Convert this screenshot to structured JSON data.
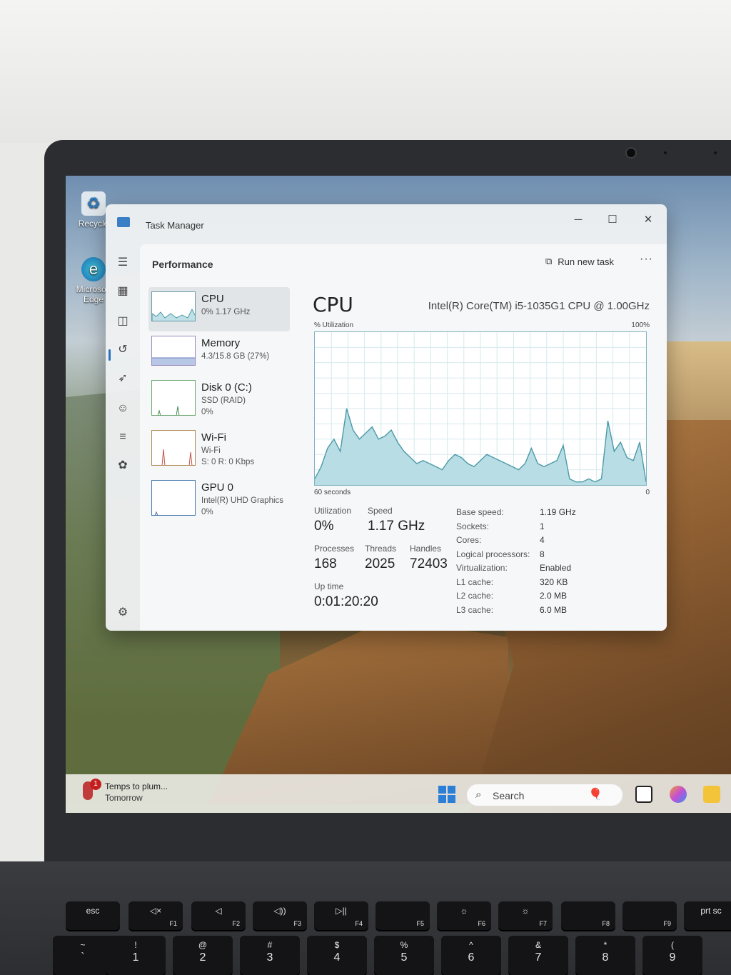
{
  "desktop": {
    "icons": [
      {
        "label": "Recycle",
        "icon": "recycle-bin-icon"
      },
      {
        "label": "Microsoft Edge",
        "icon": "edge-icon"
      }
    ]
  },
  "window": {
    "title": "Task Manager",
    "controls": {
      "minimize": "─",
      "maximize": "☐",
      "close": "✕"
    }
  },
  "header": {
    "section": "Performance",
    "run_new_task": "Run new task",
    "more": "···"
  },
  "resources": [
    {
      "name": "CPU",
      "sub1": "0%  1.17 GHz",
      "sub2": "",
      "sub3": ""
    },
    {
      "name": "Memory",
      "sub1": "4.3/15.8 GB (27%)",
      "sub2": "",
      "sub3": ""
    },
    {
      "name": "Disk 0 (C:)",
      "sub1": "SSD (RAID)",
      "sub2": "0%",
      "sub3": ""
    },
    {
      "name": "Wi-Fi",
      "sub1": "Wi-Fi",
      "sub2": "S: 0 R: 0 Kbps",
      "sub3": ""
    },
    {
      "name": "GPU 0",
      "sub1": "Intel(R) UHD Graphics",
      "sub2": "0%",
      "sub3": ""
    }
  ],
  "detail": {
    "title": "CPU",
    "model": "Intel(R) Core(TM) i5-1035G1 CPU @ 1.00GHz",
    "util_label": "% Utilization",
    "util_max": "100%",
    "time_left": "60 seconds",
    "time_right": "0",
    "stats": {
      "utilization_label": "Utilization",
      "utilization": "0%",
      "speed_label": "Speed",
      "speed": "1.17 GHz",
      "processes_label": "Processes",
      "processes": "168",
      "threads_label": "Threads",
      "threads": "2025",
      "handles_label": "Handles",
      "handles": "72403",
      "uptime_label": "Up time",
      "uptime": "0:01:20:20"
    },
    "specs": [
      {
        "label": "Base speed:",
        "value": "1.19 GHz"
      },
      {
        "label": "Sockets:",
        "value": "1"
      },
      {
        "label": "Cores:",
        "value": "4"
      },
      {
        "label": "Logical processors:",
        "value": "8"
      },
      {
        "label": "Virtualization:",
        "value": "Enabled"
      },
      {
        "label": "L1 cache:",
        "value": "320 KB"
      },
      {
        "label": "L2 cache:",
        "value": "2.0 MB"
      },
      {
        "label": "L3 cache:",
        "value": "6.0 MB"
      }
    ]
  },
  "chart_data": {
    "type": "area",
    "ylim": [
      0,
      100
    ],
    "values": [
      4,
      12,
      24,
      30,
      22,
      50,
      36,
      30,
      34,
      38,
      30,
      32,
      36,
      28,
      22,
      18,
      14,
      16,
      14,
      12,
      10,
      16,
      20,
      18,
      14,
      12,
      16,
      20,
      18,
      16,
      14,
      12,
      10,
      14,
      24,
      14,
      12,
      14,
      16,
      26,
      4,
      2,
      2,
      4,
      2,
      4,
      42,
      22,
      28,
      18,
      16,
      28,
      2
    ]
  },
  "taskbar": {
    "weather_title": "Temps to plum...",
    "weather_sub": "Tomorrow",
    "weather_badge": "1",
    "search": "Search"
  },
  "keyboard": [
    {
      "top": "esc",
      "bot": ""
    },
    {
      "top": "◁×",
      "bot": "F1"
    },
    {
      "top": "◁",
      "bot": "F2"
    },
    {
      "top": "◁))",
      "bot": "F3"
    },
    {
      "top": "▷||",
      "bot": "F4"
    },
    {
      "top": "",
      "bot": "F5"
    },
    {
      "top": "☼",
      "bot": "F6"
    },
    {
      "top": "☼",
      "bot": "F7"
    },
    {
      "top": "",
      "bot": "F8"
    },
    {
      "top": "",
      "bot": "F9"
    },
    {
      "top": "prt sc",
      "bot": ""
    }
  ],
  "number_row": [
    {
      "top": "~",
      "bot": "`"
    },
    {
      "top": "!",
      "bot": "1"
    },
    {
      "top": "@",
      "bot": "2"
    },
    {
      "top": "#",
      "bot": "3"
    },
    {
      "top": "$",
      "bot": "4"
    },
    {
      "top": "%",
      "bot": "5"
    },
    {
      "top": "^",
      "bot": "6"
    },
    {
      "top": "&",
      "bot": "7"
    },
    {
      "top": "*",
      "bot": "8"
    },
    {
      "top": "(",
      "bot": "9"
    }
  ]
}
